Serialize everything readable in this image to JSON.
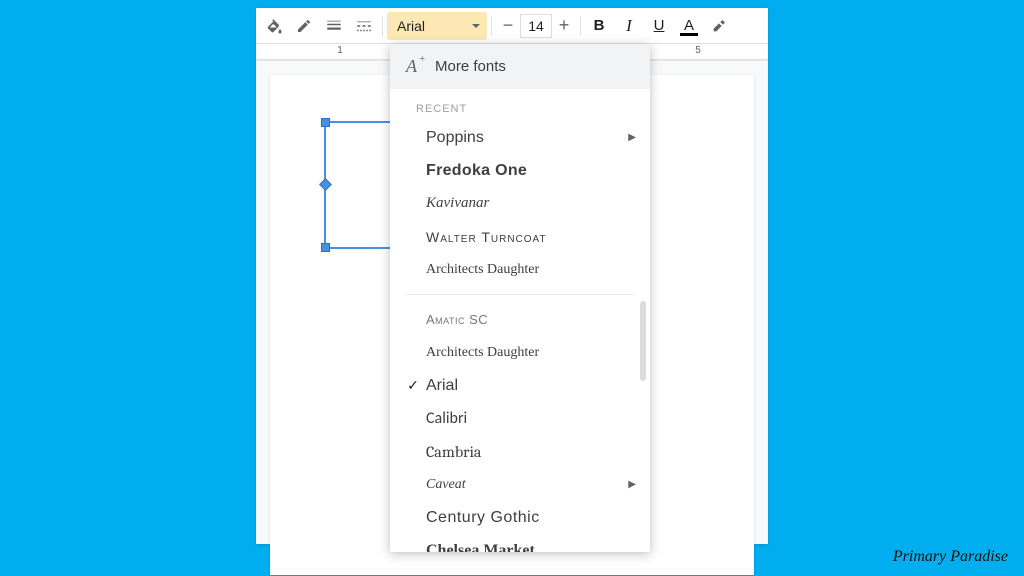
{
  "toolbar": {
    "font_name": "Arial",
    "font_size": "14"
  },
  "ruler": {
    "marks": [
      "1",
      "5"
    ]
  },
  "font_menu": {
    "more_fonts_label": "More fonts",
    "recent_label": "RECENT",
    "recent": [
      {
        "name": "Poppins",
        "css": "f-poppins",
        "submenu": true
      },
      {
        "name": "Fredoka One",
        "css": "f-fredoka"
      },
      {
        "name": "Kavivanar",
        "css": "f-kavivanar"
      },
      {
        "name": "Walter Turncoat",
        "css": "f-walter"
      },
      {
        "name": "Architects Daughter",
        "css": "f-architects"
      }
    ],
    "all": [
      {
        "name": "Amatic SC",
        "css": "f-amatic"
      },
      {
        "name": "Architects Daughter",
        "css": "f-architects"
      },
      {
        "name": "Arial",
        "css": "f-arial",
        "selected": true
      },
      {
        "name": "Calibri",
        "css": "f-calibri"
      },
      {
        "name": "Cambria",
        "css": "f-cambria"
      },
      {
        "name": "Caveat",
        "css": "f-caveat",
        "submenu": true
      },
      {
        "name": "Century Gothic",
        "css": "f-century"
      },
      {
        "name": "Chelsea Market",
        "css": "f-chelsea"
      }
    ]
  },
  "watermark": "Primary Paradise"
}
